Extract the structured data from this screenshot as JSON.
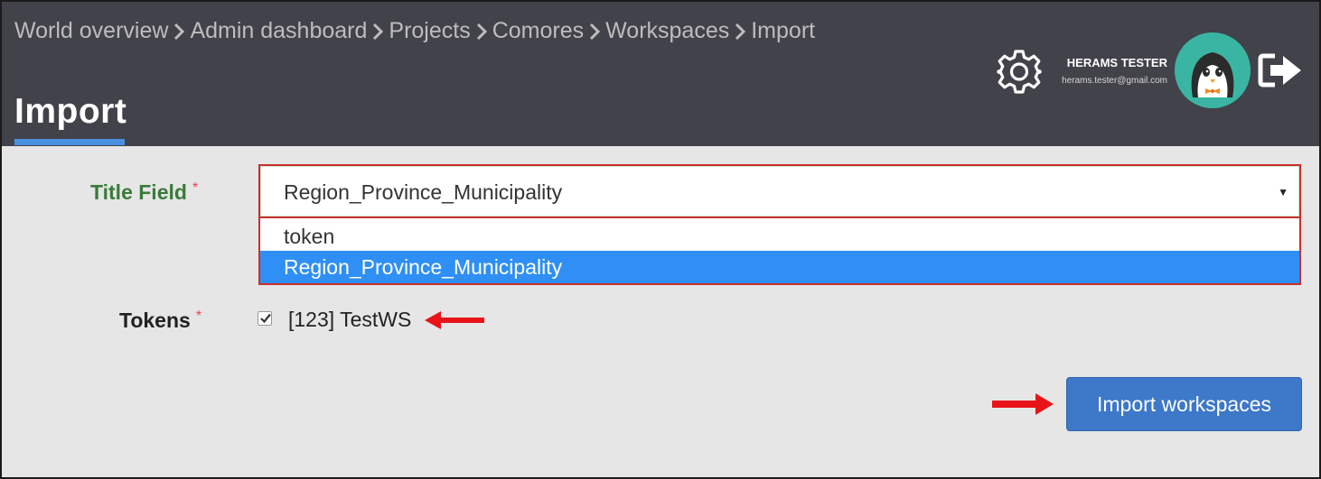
{
  "breadcrumb": {
    "items": [
      {
        "label": "World overview"
      },
      {
        "label": "Admin dashboard"
      },
      {
        "label": "Projects"
      },
      {
        "label": "Comores"
      },
      {
        "label": "Workspaces"
      },
      {
        "label": "Import"
      }
    ]
  },
  "page": {
    "title": "Import"
  },
  "user": {
    "name": "HERAMS TESTER",
    "email": "herams.tester@gmail.com"
  },
  "icons": {
    "settings": "gear-icon",
    "avatar": "penguin-avatar-icon",
    "logout": "logout-icon"
  },
  "form": {
    "title_field": {
      "label": "Title Field",
      "required_mark": "*",
      "selected_value": "Region_Province_Municipality",
      "options": [
        {
          "label": "token"
        },
        {
          "label": "Region_Province_Municipality"
        }
      ]
    },
    "tokens": {
      "label": "Tokens",
      "required_mark": "*",
      "items": [
        {
          "label": "[123] TestWS",
          "checked": true
        }
      ]
    },
    "submit_label": "Import workspaces"
  },
  "colors": {
    "header_bg": "#42424a",
    "content_bg": "#e6e6e6",
    "accent": "#4a90e2",
    "button": "#3d78c9",
    "selected_option": "#2f8ff5",
    "error_border": "#c9302c",
    "annotation_arrow": "#e8141a"
  }
}
